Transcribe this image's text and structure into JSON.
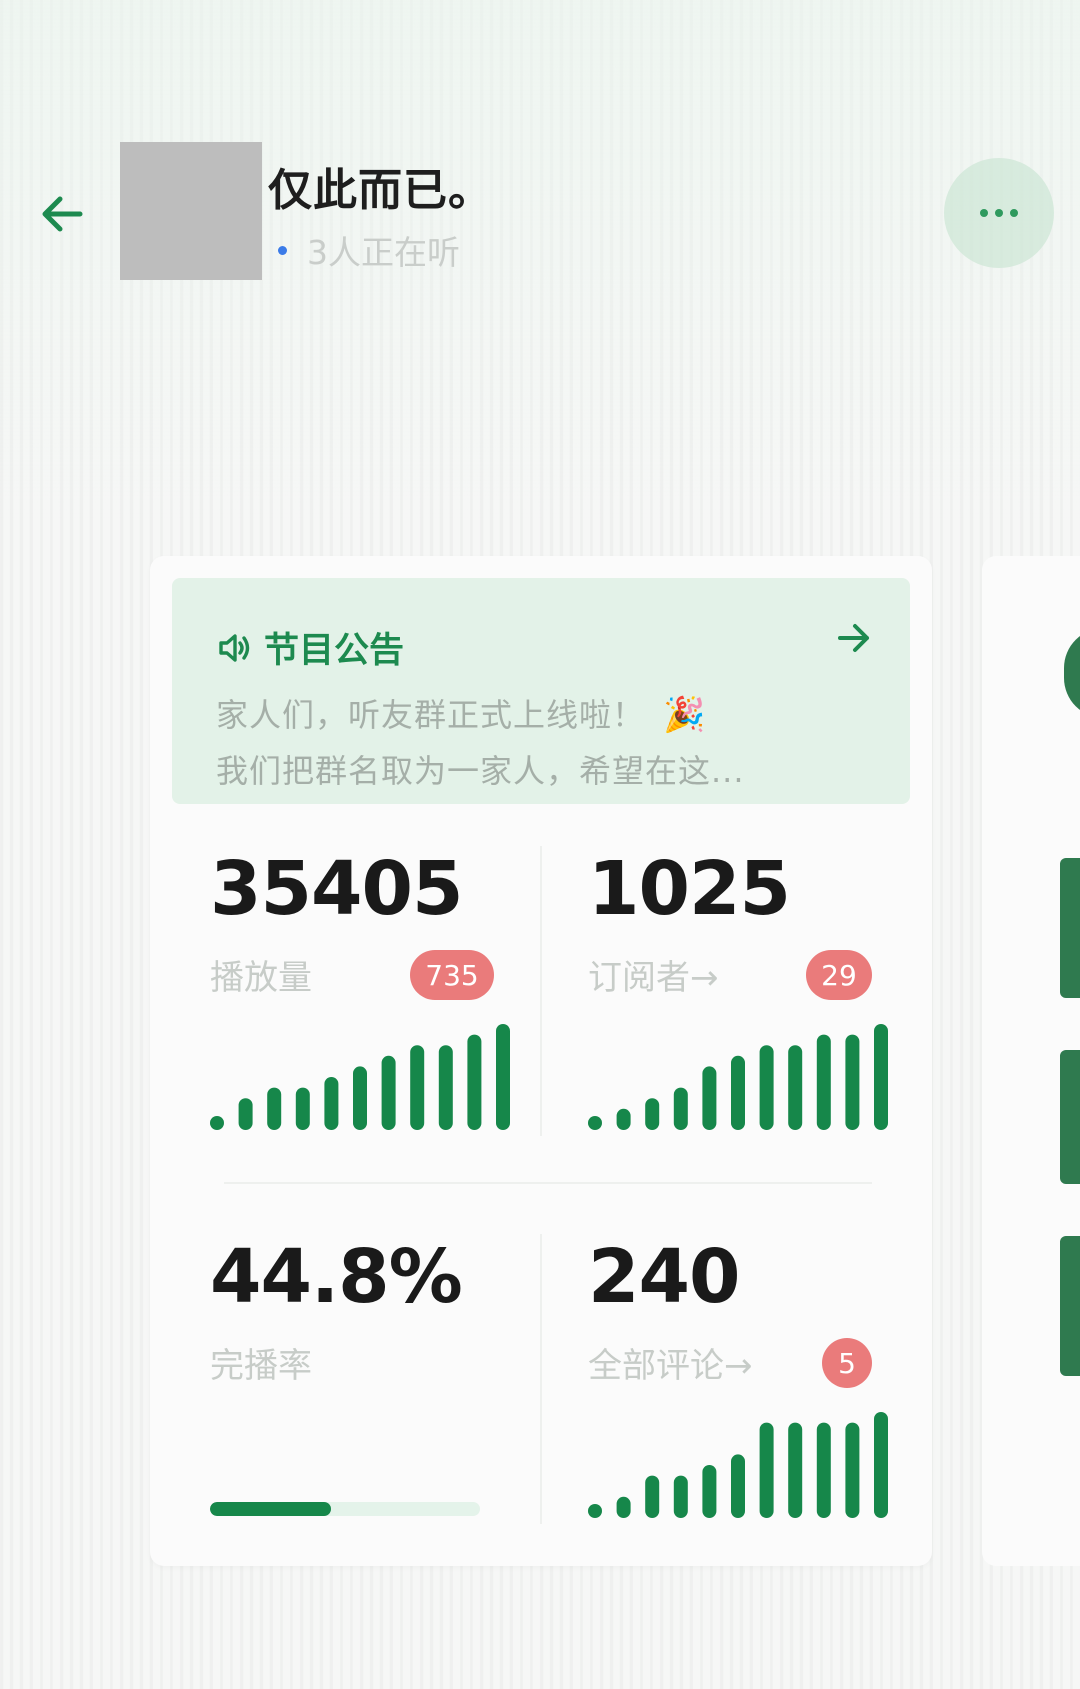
{
  "colors": {
    "brand_green": "#1d8a4f",
    "bar_green": "#16874a",
    "notice_bg": "#e3f2e8",
    "badge_red": "#ea7b7b",
    "listening_dot": "#3b7be8",
    "more_dots": "#2f9a5e"
  },
  "header": {
    "back_icon": "arrow-left-icon",
    "title": "仅此而已。",
    "listening_text": "3人正在听",
    "more_icon": "more-dots-icon"
  },
  "notice": {
    "icon": "speaker-icon",
    "title": "节目公告",
    "arrow_icon": "arrow-right-icon",
    "line1": "家人们，听友群正式上线啦！",
    "line1_emoji": "🎉",
    "line2": "我们把群名取为一家人，希望在这..."
  },
  "stats": {
    "plays": {
      "value": "35405",
      "label": "播放量",
      "badge": "735"
    },
    "subscribers": {
      "value": "1025",
      "label": "订阅者→",
      "badge": "29"
    },
    "completion": {
      "value": "44.8%",
      "label": "完播率",
      "progress": 0.448
    },
    "comments": {
      "value": "240",
      "label": "全部评论→",
      "badge": "5"
    }
  },
  "chart_data": [
    {
      "type": "bar",
      "values": [
        1,
        3,
        4,
        4,
        5,
        6,
        7,
        8,
        8,
        9,
        10
      ]
    },
    {
      "type": "bar",
      "values": [
        1,
        2,
        3,
        4,
        6,
        7,
        8,
        8,
        9,
        9,
        10
      ]
    },
    {
      "type": "bar",
      "values": [
        1,
        2,
        4,
        4,
        5,
        6,
        9,
        9,
        9,
        9,
        10
      ]
    }
  ]
}
